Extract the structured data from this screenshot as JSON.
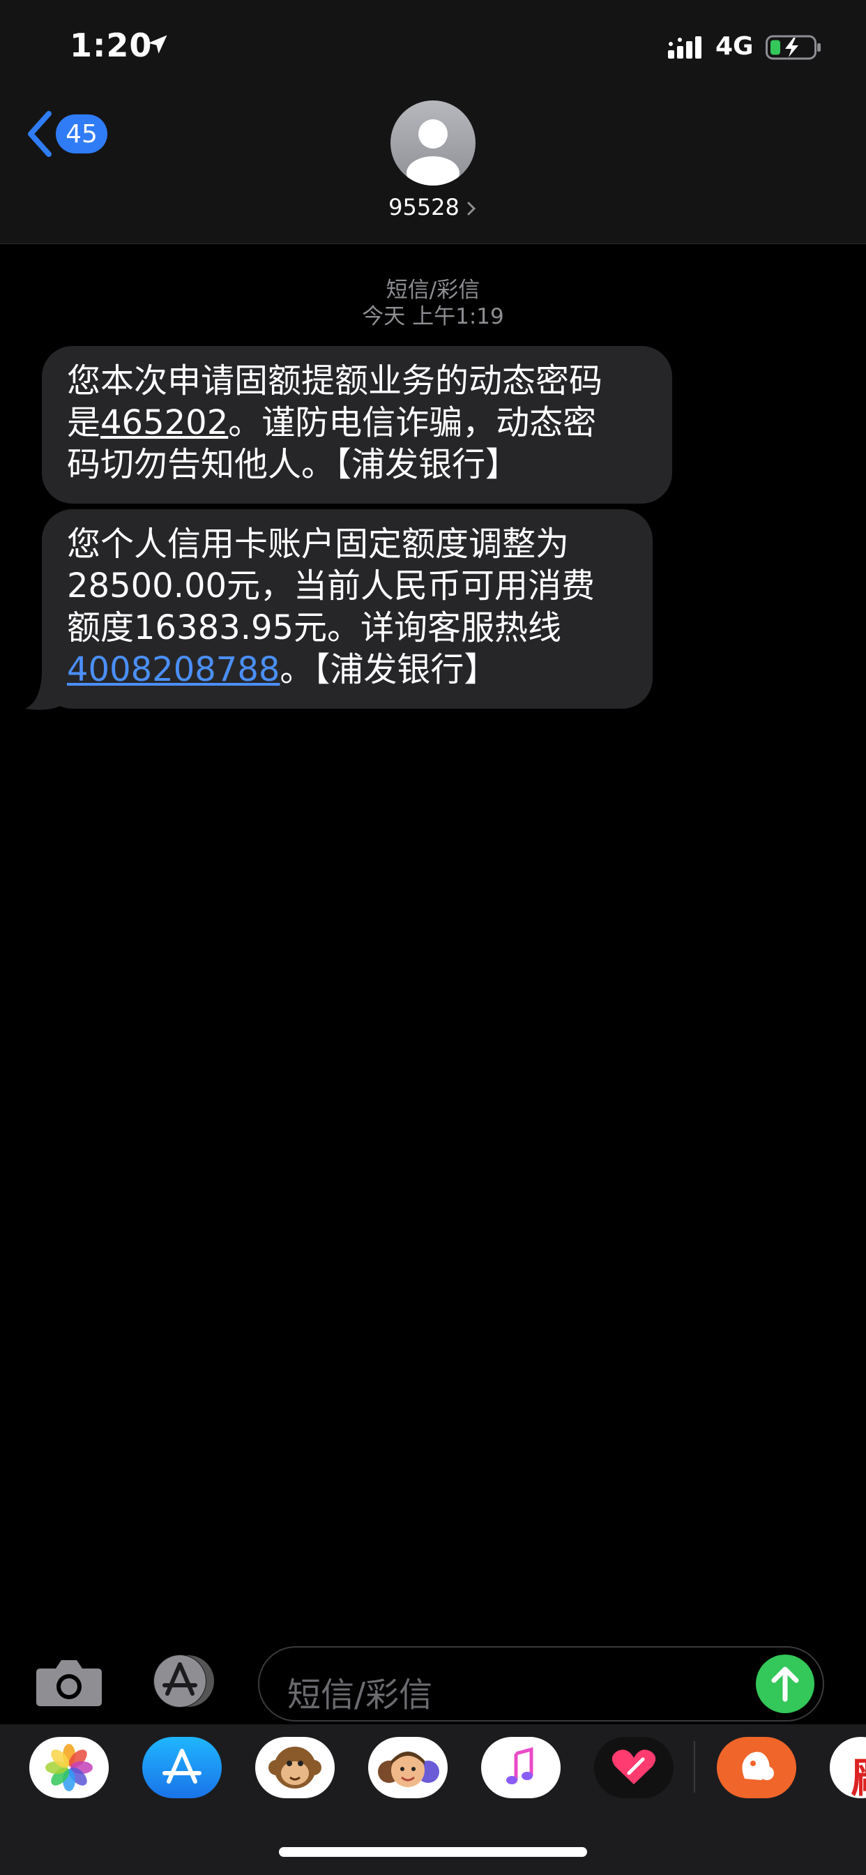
{
  "status_bar": {
    "time": "1:20",
    "network": "4G",
    "icons": [
      "location-arrow-icon",
      "signal-icon",
      "battery-charging-icon"
    ]
  },
  "nav": {
    "back_badge": "45",
    "contact_name": "95528"
  },
  "conversation": {
    "service_label": "短信/彩信",
    "timestamp": "今天 上午1:19",
    "messages": [
      {
        "line1": "您本次申请固额提额业务的动态密码",
        "line2_pre": "是",
        "code": "465202",
        "line2_post": "。谨防电信诈骗，动态密",
        "line3": "码切勿告知他人。【浦发银行】"
      },
      {
        "line1": "您个人信用卡账户固定额度调整为",
        "line2": "28500.00元，当前人民币可用消费",
        "line3": "额度16383.95元。详询客服热线",
        "phone": "4008208788",
        "line4_post": "。【浦发银行】"
      }
    ]
  },
  "composer": {
    "placeholder": "短信/彩信",
    "icons": [
      "camera-icon",
      "app-store-icon",
      "send-arrow-icon"
    ]
  },
  "app_drawer": {
    "apps": [
      "photos",
      "app-store",
      "animoji",
      "memoji-stickers",
      "music",
      "digital-touch",
      "orange-app",
      "partial-app"
    ],
    "partial_app_glyph": "厰"
  },
  "colors": {
    "accent_blue": "#2f7cf6",
    "link_blue": "#4b8ff8",
    "bubble_gray": "#262629",
    "send_green": "#34c759"
  }
}
